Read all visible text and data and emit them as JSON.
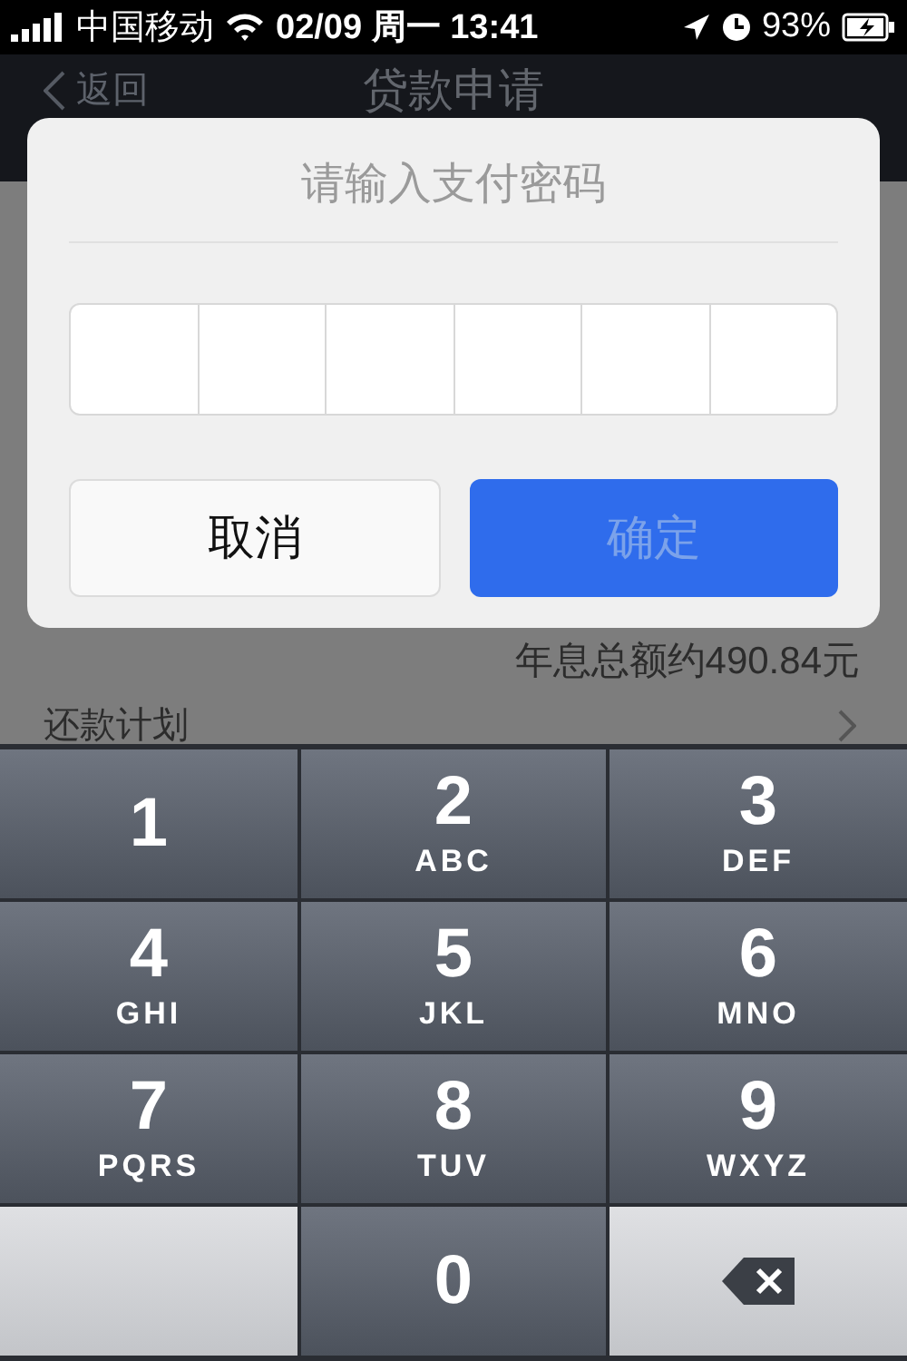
{
  "status_bar": {
    "carrier": "中国移动",
    "time": "02/09 周一 13:41",
    "battery": "93%"
  },
  "nav": {
    "back": "返回",
    "title": "贷款申请"
  },
  "page": {
    "interest": "年息总额约490.84元",
    "plan": "还款计划"
  },
  "dialog": {
    "title": "请输入支付密码",
    "pin_boxes": [
      {
        "filled": false
      },
      {
        "filled": false
      },
      {
        "filled": false
      },
      {
        "filled": false
      },
      {
        "filled": false
      },
      {
        "filled": false
      }
    ],
    "cancel": {
      "label": "取消",
      "disabled": false
    },
    "confirm": {
      "label": "确定",
      "disabled": true
    }
  },
  "keypad": [
    {
      "kind": "digit",
      "digit": "1"
    },
    {
      "kind": "digit",
      "digit": "2",
      "letters": "ABC"
    },
    {
      "kind": "digit",
      "digit": "3",
      "letters": "DEF"
    },
    {
      "kind": "digit",
      "digit": "4",
      "letters": "GHI"
    },
    {
      "kind": "digit",
      "digit": "5",
      "letters": "JKL"
    },
    {
      "kind": "digit",
      "digit": "6",
      "letters": "MNO"
    },
    {
      "kind": "digit",
      "digit": "7",
      "letters": "PQRS"
    },
    {
      "kind": "digit",
      "digit": "8",
      "letters": "TUV"
    },
    {
      "kind": "digit",
      "digit": "9",
      "letters": "WXYZ"
    },
    {
      "kind": "blank"
    },
    {
      "kind": "digit",
      "digit": "0"
    },
    {
      "kind": "delete"
    }
  ]
}
